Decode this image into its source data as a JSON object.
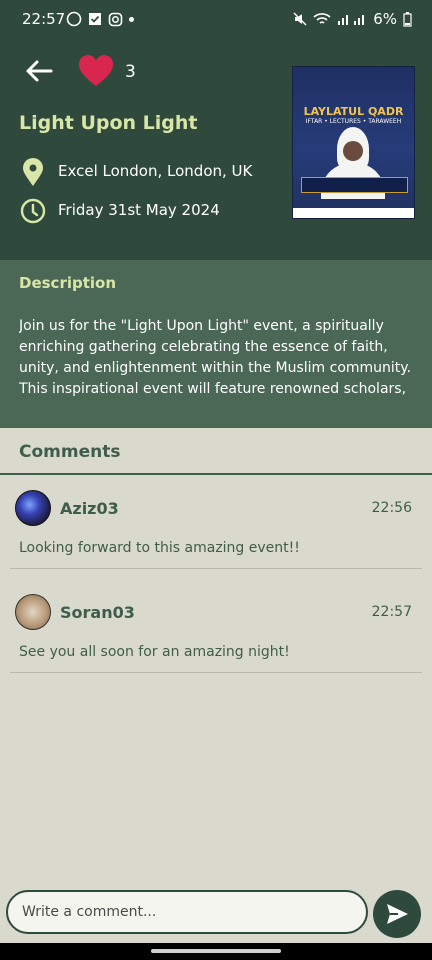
{
  "status_bar": {
    "time": "22:57",
    "battery": "6%"
  },
  "header": {
    "likes_count": "3",
    "title": "Light Upon Light",
    "location": "Excel London, London, UK",
    "date": "Friday 31st May 2024",
    "poster": {
      "heading": "LAYLATUL QADR",
      "subheading": "IFTAR • LECTURES • TARAWEEH"
    }
  },
  "description": {
    "label": "Description",
    "text": "Join us for the \"Light Upon Light\" event, a spiritually enriching gathering celebrating the essence of faith, unity, and enlightenment within the Muslim community. This inspirational event will feature renowned scholars,"
  },
  "comments": {
    "label": "Comments",
    "items": [
      {
        "username": "Aziz03",
        "time": "22:56",
        "text": "Looking forward to this amazing event!!"
      },
      {
        "username": "Soran03",
        "time": "22:57",
        "text": "See you all soon for an amazing night!"
      }
    ]
  },
  "composer": {
    "placeholder": "Write a comment..."
  },
  "colors": {
    "header_bg": "#2f4a3d",
    "description_bg": "#4b6856",
    "page_bg": "#dad9cd",
    "accent_text": "#d8e7a7",
    "heart": "#d8264f"
  },
  "icons": [
    "back-arrow-icon",
    "heart-icon",
    "location-pin-icon",
    "clock-icon",
    "send-icon"
  ]
}
